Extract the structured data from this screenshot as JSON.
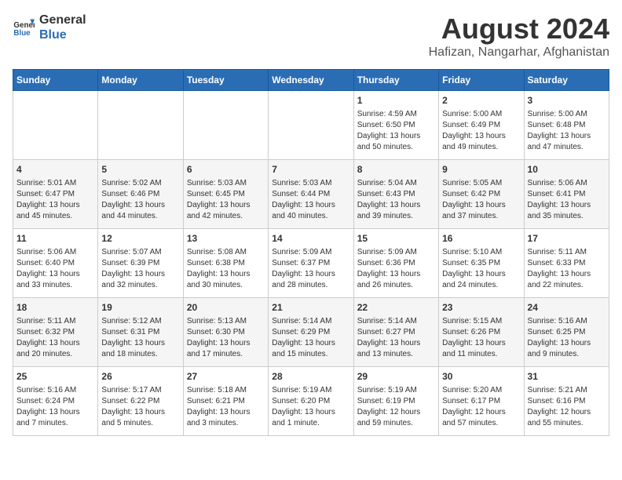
{
  "logo": {
    "line1": "General",
    "line2": "Blue"
  },
  "title": "August 2024",
  "subtitle": "Hafizan, Nangarhar, Afghanistan",
  "days_header": [
    "Sunday",
    "Monday",
    "Tuesday",
    "Wednesday",
    "Thursday",
    "Friday",
    "Saturday"
  ],
  "weeks": [
    [
      {
        "day": "",
        "info": ""
      },
      {
        "day": "",
        "info": ""
      },
      {
        "day": "",
        "info": ""
      },
      {
        "day": "",
        "info": ""
      },
      {
        "day": "1",
        "info": "Sunrise: 4:59 AM\nSunset: 6:50 PM\nDaylight: 13 hours\nand 50 minutes."
      },
      {
        "day": "2",
        "info": "Sunrise: 5:00 AM\nSunset: 6:49 PM\nDaylight: 13 hours\nand 49 minutes."
      },
      {
        "day": "3",
        "info": "Sunrise: 5:00 AM\nSunset: 6:48 PM\nDaylight: 13 hours\nand 47 minutes."
      }
    ],
    [
      {
        "day": "4",
        "info": "Sunrise: 5:01 AM\nSunset: 6:47 PM\nDaylight: 13 hours\nand 45 minutes."
      },
      {
        "day": "5",
        "info": "Sunrise: 5:02 AM\nSunset: 6:46 PM\nDaylight: 13 hours\nand 44 minutes."
      },
      {
        "day": "6",
        "info": "Sunrise: 5:03 AM\nSunset: 6:45 PM\nDaylight: 13 hours\nand 42 minutes."
      },
      {
        "day": "7",
        "info": "Sunrise: 5:03 AM\nSunset: 6:44 PM\nDaylight: 13 hours\nand 40 minutes."
      },
      {
        "day": "8",
        "info": "Sunrise: 5:04 AM\nSunset: 6:43 PM\nDaylight: 13 hours\nand 39 minutes."
      },
      {
        "day": "9",
        "info": "Sunrise: 5:05 AM\nSunset: 6:42 PM\nDaylight: 13 hours\nand 37 minutes."
      },
      {
        "day": "10",
        "info": "Sunrise: 5:06 AM\nSunset: 6:41 PM\nDaylight: 13 hours\nand 35 minutes."
      }
    ],
    [
      {
        "day": "11",
        "info": "Sunrise: 5:06 AM\nSunset: 6:40 PM\nDaylight: 13 hours\nand 33 minutes."
      },
      {
        "day": "12",
        "info": "Sunrise: 5:07 AM\nSunset: 6:39 PM\nDaylight: 13 hours\nand 32 minutes."
      },
      {
        "day": "13",
        "info": "Sunrise: 5:08 AM\nSunset: 6:38 PM\nDaylight: 13 hours\nand 30 minutes."
      },
      {
        "day": "14",
        "info": "Sunrise: 5:09 AM\nSunset: 6:37 PM\nDaylight: 13 hours\nand 28 minutes."
      },
      {
        "day": "15",
        "info": "Sunrise: 5:09 AM\nSunset: 6:36 PM\nDaylight: 13 hours\nand 26 minutes."
      },
      {
        "day": "16",
        "info": "Sunrise: 5:10 AM\nSunset: 6:35 PM\nDaylight: 13 hours\nand 24 minutes."
      },
      {
        "day": "17",
        "info": "Sunrise: 5:11 AM\nSunset: 6:33 PM\nDaylight: 13 hours\nand 22 minutes."
      }
    ],
    [
      {
        "day": "18",
        "info": "Sunrise: 5:11 AM\nSunset: 6:32 PM\nDaylight: 13 hours\nand 20 minutes."
      },
      {
        "day": "19",
        "info": "Sunrise: 5:12 AM\nSunset: 6:31 PM\nDaylight: 13 hours\nand 18 minutes."
      },
      {
        "day": "20",
        "info": "Sunrise: 5:13 AM\nSunset: 6:30 PM\nDaylight: 13 hours\nand 17 minutes."
      },
      {
        "day": "21",
        "info": "Sunrise: 5:14 AM\nSunset: 6:29 PM\nDaylight: 13 hours\nand 15 minutes."
      },
      {
        "day": "22",
        "info": "Sunrise: 5:14 AM\nSunset: 6:27 PM\nDaylight: 13 hours\nand 13 minutes."
      },
      {
        "day": "23",
        "info": "Sunrise: 5:15 AM\nSunset: 6:26 PM\nDaylight: 13 hours\nand 11 minutes."
      },
      {
        "day": "24",
        "info": "Sunrise: 5:16 AM\nSunset: 6:25 PM\nDaylight: 13 hours\nand 9 minutes."
      }
    ],
    [
      {
        "day": "25",
        "info": "Sunrise: 5:16 AM\nSunset: 6:24 PM\nDaylight: 13 hours\nand 7 minutes."
      },
      {
        "day": "26",
        "info": "Sunrise: 5:17 AM\nSunset: 6:22 PM\nDaylight: 13 hours\nand 5 minutes."
      },
      {
        "day": "27",
        "info": "Sunrise: 5:18 AM\nSunset: 6:21 PM\nDaylight: 13 hours\nand 3 minutes."
      },
      {
        "day": "28",
        "info": "Sunrise: 5:19 AM\nSunset: 6:20 PM\nDaylight: 13 hours\nand 1 minute."
      },
      {
        "day": "29",
        "info": "Sunrise: 5:19 AM\nSunset: 6:19 PM\nDaylight: 12 hours\nand 59 minutes."
      },
      {
        "day": "30",
        "info": "Sunrise: 5:20 AM\nSunset: 6:17 PM\nDaylight: 12 hours\nand 57 minutes."
      },
      {
        "day": "31",
        "info": "Sunrise: 5:21 AM\nSunset: 6:16 PM\nDaylight: 12 hours\nand 55 minutes."
      }
    ]
  ]
}
